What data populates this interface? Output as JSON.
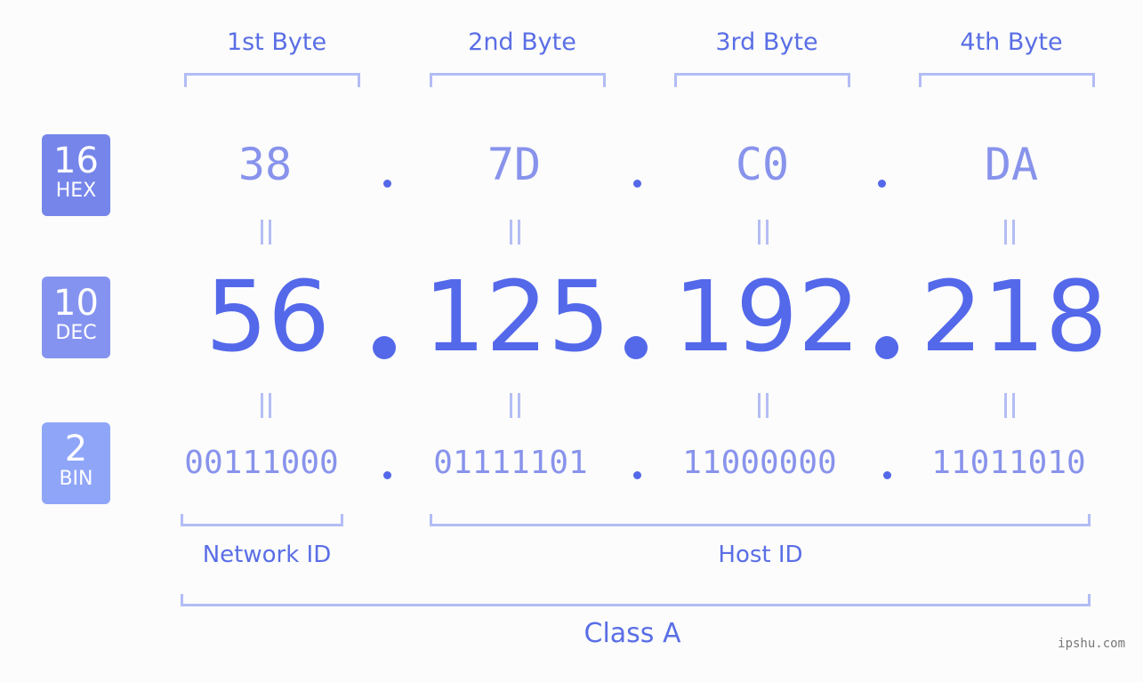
{
  "byte_headers": [
    "1st Byte",
    "2nd Byte",
    "3rd Byte",
    "4th Byte"
  ],
  "bases": {
    "hex": {
      "num": "16",
      "label": "HEX",
      "color": "#7585ea"
    },
    "dec": {
      "num": "10",
      "label": "DEC",
      "color": "#8593f0"
    },
    "bin": {
      "num": "2",
      "label": "BIN",
      "color": "#8fa5f8"
    }
  },
  "ip": {
    "hex": [
      "38",
      "7D",
      "C0",
      "DA"
    ],
    "dec": [
      "56",
      "125",
      "192",
      "218"
    ],
    "bin": [
      "00111000",
      "01111101",
      "11000000",
      "11011010"
    ]
  },
  "sections": {
    "network_id": "Network ID",
    "host_id": "Host ID",
    "class": "Class A"
  },
  "watermark": "ipshu.com",
  "colors": {
    "accent": "#5468ea",
    "light": "#b2bcf5",
    "mid": "#8893ec"
  }
}
